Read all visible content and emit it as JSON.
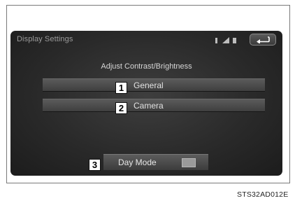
{
  "screen": {
    "title": "Display Settings",
    "heading": "Adjust Contrast/Brightness",
    "status_icons": [
      "bluetooth-icon",
      "signal-bars-icon",
      "battery-icon"
    ],
    "back_icon": "back-arrow-icon"
  },
  "menu": {
    "items": [
      {
        "label": "General",
        "callout": "1"
      },
      {
        "label": "Camera",
        "callout": "2"
      }
    ]
  },
  "mode_toggle": {
    "label": "Day Mode",
    "callout": "3"
  },
  "figure_code": "STS32AD012E"
}
